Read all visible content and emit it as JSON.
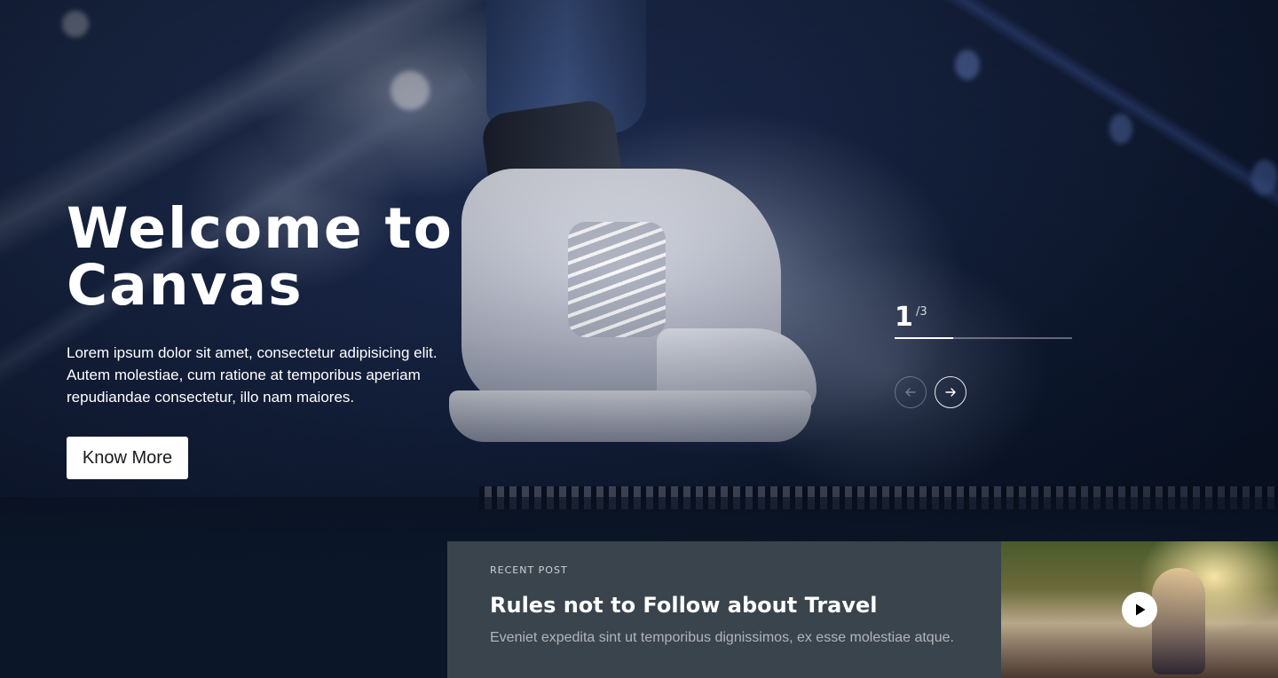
{
  "hero": {
    "title": "Welcome to Canvas",
    "description": "Lorem ipsum dolor sit amet, consectetur adipisicing elit. Autem molestiae, cum ratione at temporibus aperiam repudiandae consectetur, illo nam maiores.",
    "button_label": "Know More"
  },
  "slider": {
    "current": "1",
    "total": "/3",
    "progress_fraction": 0.33,
    "prev_icon": "arrow-left-icon",
    "next_icon": "arrow-right-icon"
  },
  "post": {
    "kicker": "RECENT POST",
    "title": "Rules not to Follow about Travel",
    "excerpt": "Eveniet expedita sint ut temporibus dignissimos, ex esse molestiae atque."
  },
  "video": {
    "icon": "play-icon"
  },
  "colors": {
    "post_panel_bg": "#3a444d",
    "page_bg": "#0b1626"
  }
}
